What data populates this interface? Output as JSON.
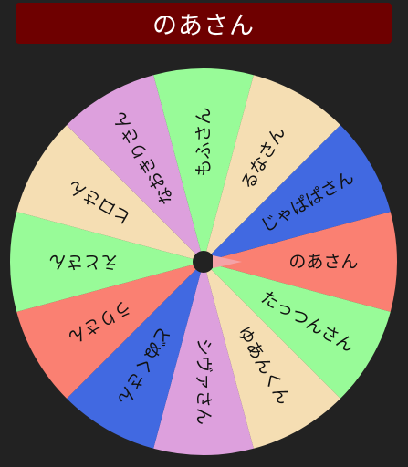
{
  "result": {
    "title": "のあさん",
    "banner_color": "#6e0000"
  },
  "wheel": {
    "center_color": "#222222",
    "pointer_color": "#f4a3a8",
    "segments": [
      {
        "label": "のあさん",
        "color": "#fa8072"
      },
      {
        "label": "たっつんさん",
        "color": "#98fb98"
      },
      {
        "label": "ゆあんくん",
        "color": "#f5deb3"
      },
      {
        "label": "シヴァさん",
        "color": "#dda0dd"
      },
      {
        "label": "どぬくさん",
        "color": "#4169e1"
      },
      {
        "label": "うりさん",
        "color": "#fa8072"
      },
      {
        "label": "えとさん",
        "color": "#98fb98"
      },
      {
        "label": "ヒロさん",
        "color": "#f5deb3"
      },
      {
        "label": "なおきりさん",
        "color": "#dda0dd"
      },
      {
        "label": "もふさん",
        "color": "#98fb98"
      },
      {
        "label": "るなさん",
        "color": "#f5deb3"
      },
      {
        "label": "じゃぱぱさん",
        "color": "#4169e1"
      }
    ]
  }
}
